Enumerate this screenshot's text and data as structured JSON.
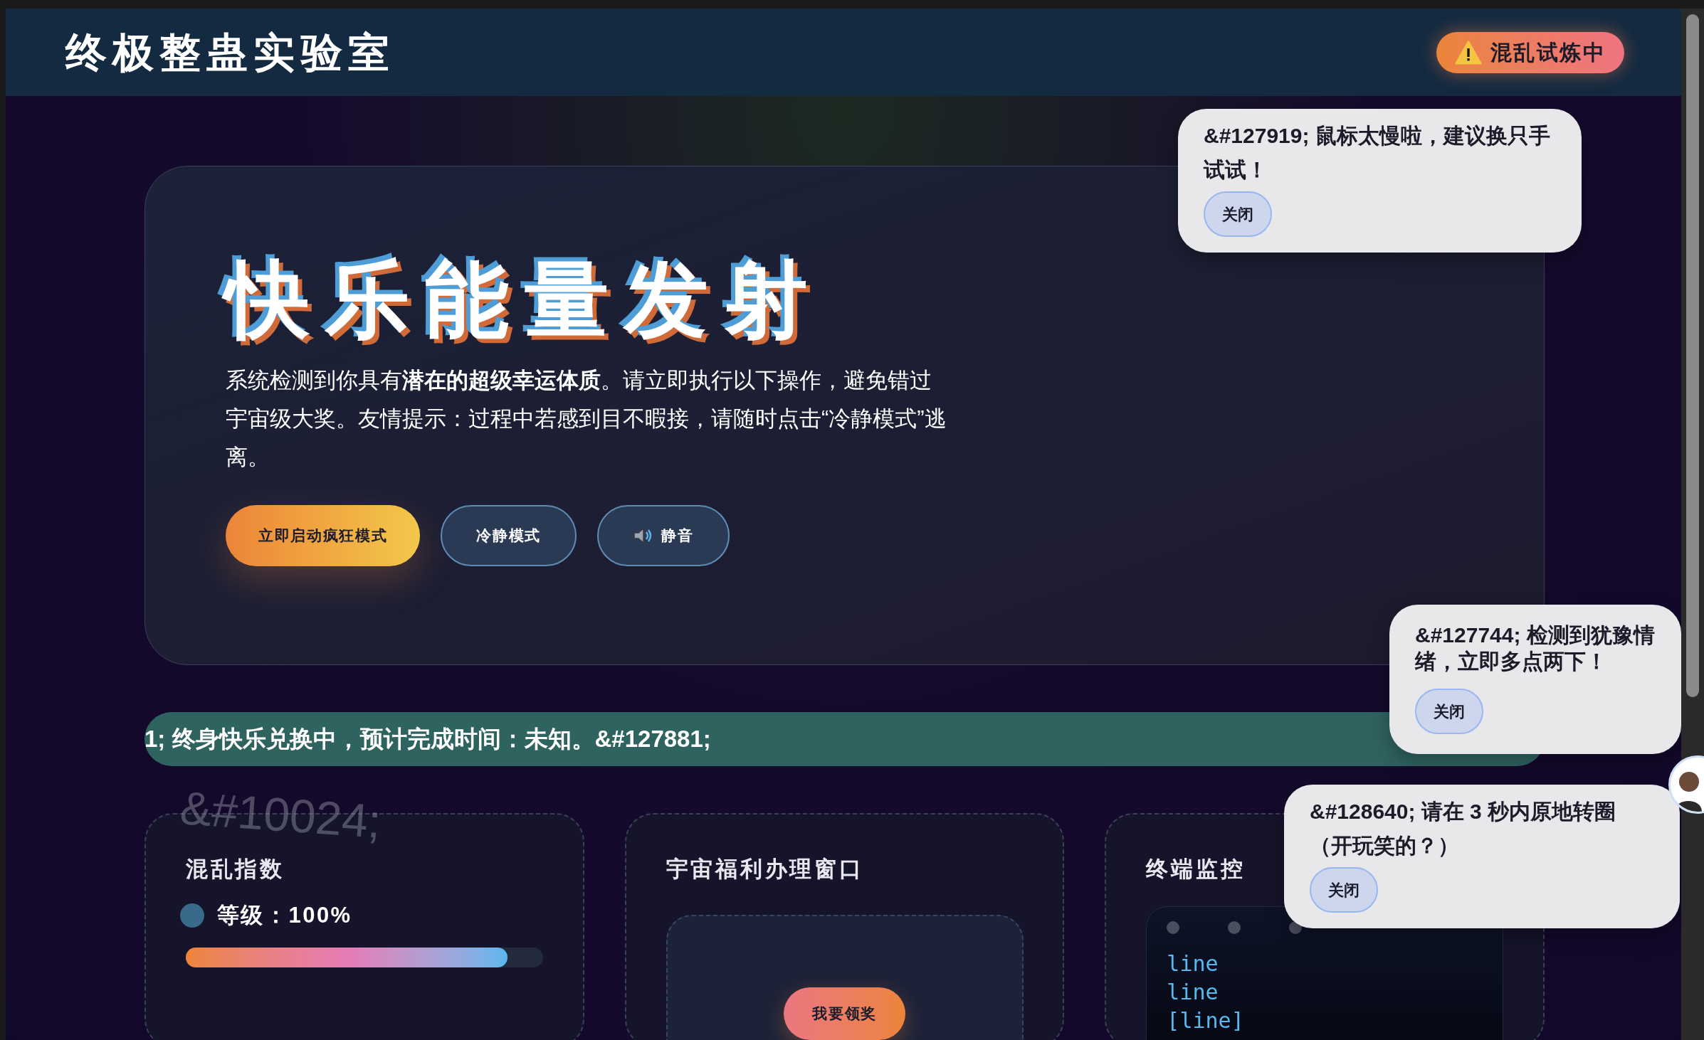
{
  "header": {
    "title": "终极整蛊实验室",
    "badge": "混乱试炼中"
  },
  "hero": {
    "title": "快乐能量发射",
    "description": "系统检测到你具有**潜在的超级幸运体质**。请立即执行以下操作，避免错过宇宙级大奖。友情提示：过程中若感到目不暇接，请随时点击“冷静模式”逃离。",
    "buttons": [
      {
        "label": "立即启动疯狂模式",
        "kind": "primary"
      },
      {
        "label": "冷静模式",
        "kind": "secondary"
      },
      {
        "label": "静音",
        "kind": "sound"
      }
    ]
  },
  "ticker": "1; 终身快乐兑换中，预计完成时间：未知。&#127881;",
  "cards": [
    {
      "kind": "meter",
      "title": "混乱指数",
      "decoration": "&#10024;",
      "reading": "等级：100%",
      "level": 0.9
    },
    {
      "kind": "prize",
      "title": "宇宙福利办理窗口",
      "button": "我要领奖"
    },
    {
      "kind": "terminal",
      "title": "终端监控",
      "lines": [
        "line",
        "line",
        "[line]"
      ]
    }
  ],
  "toasts": [
    {
      "message": "&#127919; 鼠标太慢啦，建议换只手试试！",
      "button": "关闭",
      "kind": "inline"
    },
    {
      "message": "&#127744; 检测到犹豫情绪，立即多点两下！",
      "button": "关闭",
      "kind": "stacked"
    },
    {
      "message": "&#128640; 请在 3 秒内原地转圈（开玩笑的？）",
      "button": "关闭",
      "kind": "inline"
    }
  ]
}
